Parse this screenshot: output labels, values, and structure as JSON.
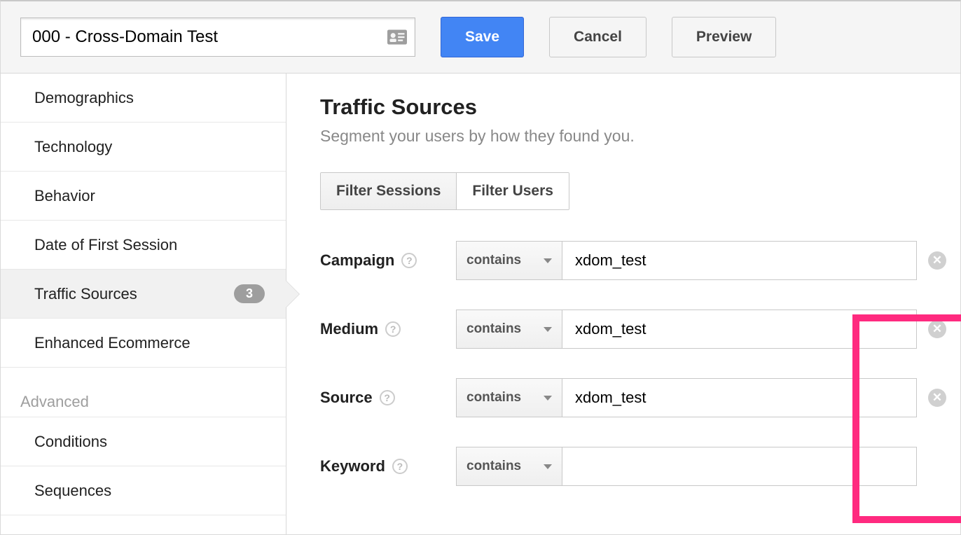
{
  "header": {
    "segment_name": "000 - Cross-Domain Test",
    "save": "Save",
    "cancel": "Cancel",
    "preview": "Preview"
  },
  "sidebar": {
    "items": [
      {
        "label": "Demographics"
      },
      {
        "label": "Technology"
      },
      {
        "label": "Behavior"
      },
      {
        "label": "Date of First Session"
      },
      {
        "label": "Traffic Sources",
        "badge": "3",
        "active": true
      },
      {
        "label": "Enhanced Ecommerce"
      }
    ],
    "advanced_header": "Advanced",
    "advanced_items": [
      {
        "label": "Conditions"
      },
      {
        "label": "Sequences"
      }
    ]
  },
  "main": {
    "title": "Traffic Sources",
    "subtitle": "Segment your users by how they found you.",
    "tabs": {
      "sessions": "Filter Sessions",
      "users": "Filter Users"
    },
    "filters": [
      {
        "label": "Campaign",
        "op": "contains",
        "value": "xdom_test",
        "clearable": true
      },
      {
        "label": "Medium",
        "op": "contains",
        "value": "xdom_test",
        "clearable": true
      },
      {
        "label": "Source",
        "op": "contains",
        "value": "xdom_test",
        "clearable": true
      },
      {
        "label": "Keyword",
        "op": "contains",
        "value": "",
        "clearable": false
      }
    ]
  },
  "highlight_color": "#ff2a7f"
}
